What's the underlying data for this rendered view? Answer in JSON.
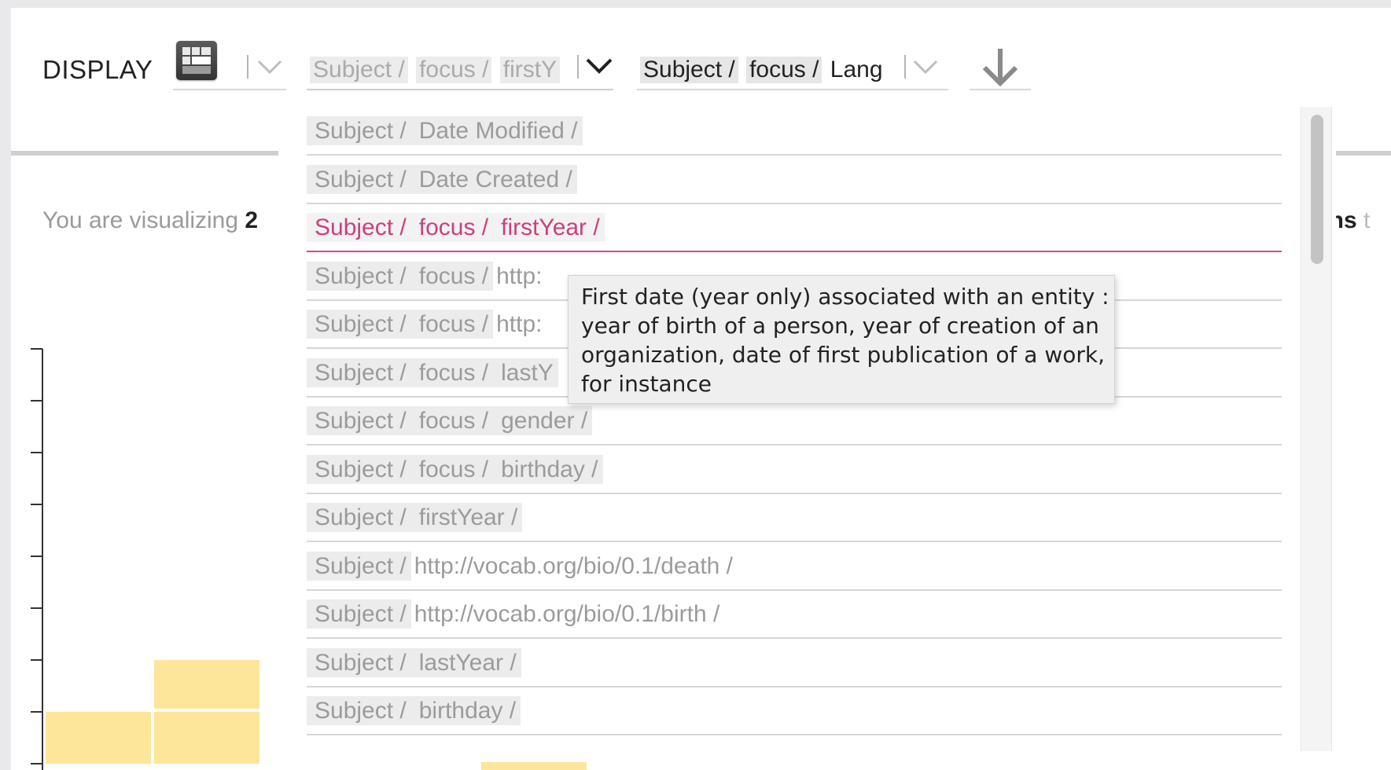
{
  "toolbar": {
    "display_label": "DISPLAY",
    "view_icon": "table-view-icon",
    "selector_2": [
      "Subject /",
      "focus /",
      "firstY"
    ],
    "selector_3": [
      "Subject /",
      "focus /",
      "Lang"
    ],
    "download_icon": "down-arrow-icon"
  },
  "background": {
    "visualizing_prefix": "You are visualizing",
    "visualizing_value": "2",
    "paths_text": "aths",
    "paths_trailing": "t"
  },
  "dropdown": {
    "options": [
      {
        "segments": [
          "Subject /",
          "Date Modified /"
        ],
        "tail": ""
      },
      {
        "segments": [
          "Subject /",
          "Date Created /"
        ],
        "tail": ""
      },
      {
        "segments": [
          "Subject /",
          "focus /",
          "firstYear /"
        ],
        "tail": "",
        "selected": true
      },
      {
        "segments": [
          "Subject /",
          "focus /"
        ],
        "tail": "http:"
      },
      {
        "segments": [
          "Subject /",
          "focus /"
        ],
        "tail": "http:"
      },
      {
        "segments": [
          "Subject /",
          "focus /",
          "lastY"
        ],
        "tail": ""
      },
      {
        "segments": [
          "Subject /",
          "focus /",
          "gender /"
        ],
        "tail": ""
      },
      {
        "segments": [
          "Subject /",
          "focus /",
          "birthday /"
        ],
        "tail": ""
      },
      {
        "segments": [
          "Subject /",
          "firstYear /"
        ],
        "tail": ""
      },
      {
        "segments": [
          "Subject /"
        ],
        "tail": "http://vocab.org/bio/0.1/death /"
      },
      {
        "segments": [
          "Subject /"
        ],
        "tail": "http://vocab.org/bio/0.1/birth /"
      },
      {
        "segments": [
          "Subject /",
          "lastYear /"
        ],
        "tail": ""
      },
      {
        "segments": [
          "Subject /",
          "birthday /"
        ],
        "tail": ""
      }
    ]
  },
  "tooltip": {
    "lines": [
      "First date (year only) associated with an entity :",
      "year of birth of a person, year of creation of an",
      "organization, date of first publication of a work,",
      "for instance"
    ]
  },
  "colors": {
    "accent": "#d6478a",
    "bar_fill": "#fde59a"
  }
}
